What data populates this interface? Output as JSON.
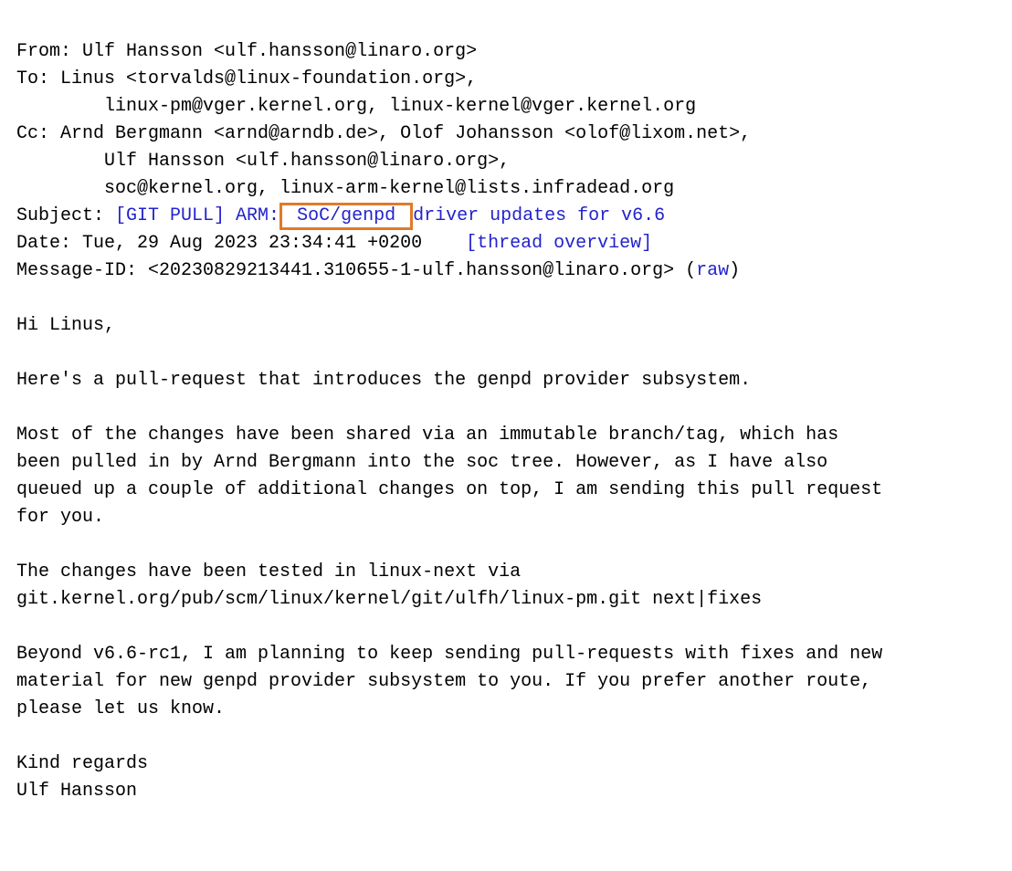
{
  "headers": {
    "from_label": "From: ",
    "from_value": "Ulf Hansson <ulf.hansson@linaro.org>",
    "to_label": "To: ",
    "to_line1": "Linus <torvalds@linux-foundation.org>,",
    "to_line2": "        linux-pm@vger.kernel.org, linux-kernel@vger.kernel.org",
    "cc_label": "Cc: ",
    "cc_line1": "Arnd Bergmann <arnd@arndb.de>, Olof Johansson <olof@lixom.net>,",
    "cc_line2": "        Ulf Hansson <ulf.hansson@linaro.org>,",
    "cc_line3": "        soc@kernel.org, linux-arm-kernel@lists.infradead.org",
    "subject_label": "Subject: ",
    "subject_link_pre": "[GIT PULL] ARM:",
    "subject_highlight": " SoC/genpd ",
    "subject_link_post": "driver updates for v6.6",
    "date_label": "Date: ",
    "date_value": "Tue, 29 Aug 2023 23:34:41 +0200",
    "date_gap": "    ",
    "thread_overview": "[thread overview]",
    "msgid_label": "Message-ID: ",
    "msgid_value": "<20230829213441.310655-1-ulf.hansson@linaro.org> (",
    "raw": "raw",
    "msgid_close": ")"
  },
  "body_text": "Hi Linus,\n\nHere's a pull-request that introduces the genpd provider subsystem.\n\nMost of the changes have been shared via an immutable branch/tag, which has\nbeen pulled in by Arnd Bergmann into the soc tree. However, as I have also\nqueued up a couple of additional changes on top, I am sending this pull request\nfor you.\n\nThe changes have been tested in linux-next via\ngit.kernel.org/pub/scm/linux/kernel/git/ulfh/linux-pm.git next|fixes\n\nBeyond v6.6-rc1, I am planning to keep sending pull-requests with fixes and new\nmaterial for new genpd provider subsystem to you. If you prefer another route,\nplease let us know.\n\nKind regards\nUlf Hansson"
}
